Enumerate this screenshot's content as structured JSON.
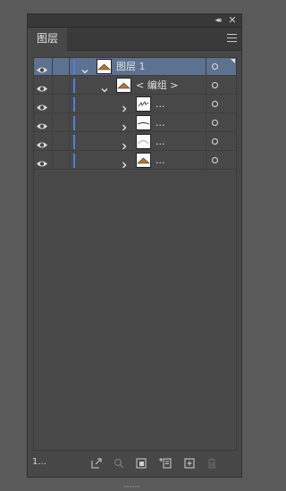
{
  "window": {
    "collapse_glyph": "◂◂",
    "close_glyph": "✕",
    "tab_label": "图层",
    "menu_icon": "hamburger-menu-icon"
  },
  "layers": [
    {
      "name": "图层 1",
      "level": 0,
      "expanded": true,
      "selected": true,
      "thumb": "mound"
    },
    {
      "name": "< 编组 >",
      "level": 1,
      "expanded": true,
      "selected": false,
      "thumb": "mound"
    },
    {
      "name": "...",
      "level": 2,
      "expanded": false,
      "selected": false,
      "thumb": "scribble"
    },
    {
      "name": "...",
      "level": 2,
      "expanded": false,
      "selected": false,
      "thumb": "line"
    },
    {
      "name": "...",
      "level": 2,
      "expanded": false,
      "selected": false,
      "thumb": "arc"
    },
    {
      "name": "...",
      "level": 2,
      "expanded": false,
      "selected": false,
      "thumb": "mound"
    }
  ],
  "footer": {
    "layer_count": "1...",
    "buttons": [
      "export-icon",
      "locate-object-icon",
      "make-clipping-mask-icon",
      "create-sublayer-icon",
      "new-layer-icon",
      "delete-icon"
    ]
  },
  "colors": {
    "panel_bg": "#474747",
    "selected_row": "#5d7190",
    "layer_color": "#4d7fe0",
    "thumb_fill": "#a8773f"
  }
}
